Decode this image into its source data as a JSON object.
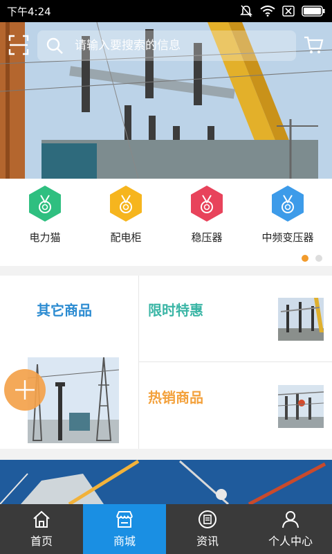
{
  "status_bar": {
    "time": "下午4:24"
  },
  "search": {
    "placeholder": "请输入要搜索的信息"
  },
  "categories": [
    {
      "label": "电力猫",
      "color": "#2fbf80"
    },
    {
      "label": "配电柜",
      "color": "#f6b51e"
    },
    {
      "label": "稳压器",
      "color": "#e8435b"
    },
    {
      "label": "中频变压器",
      "color": "#3d9be9"
    }
  ],
  "carousel": {
    "pages": 2,
    "active_page": 1,
    "active_color": "#f29b2c"
  },
  "promo": {
    "other_goods": "其它商品",
    "limited_offer": "限时特惠",
    "hot_goods": "热销商品"
  },
  "tabs": [
    {
      "label": "首页",
      "icon": "home-icon",
      "active": false
    },
    {
      "label": "商城",
      "icon": "shop-icon",
      "active": true
    },
    {
      "label": "资讯",
      "icon": "news-icon",
      "active": false
    },
    {
      "label": "个人中心",
      "icon": "user-icon",
      "active": false
    }
  ],
  "colors": {
    "tab_active": "#1a8fe3",
    "tab_bar": "#3a3a3a",
    "other_goods_title": "#2b8bd1",
    "limited_title": "#3ab5a5",
    "hot_title": "#f3a13c",
    "fab": "#f4a24b"
  }
}
